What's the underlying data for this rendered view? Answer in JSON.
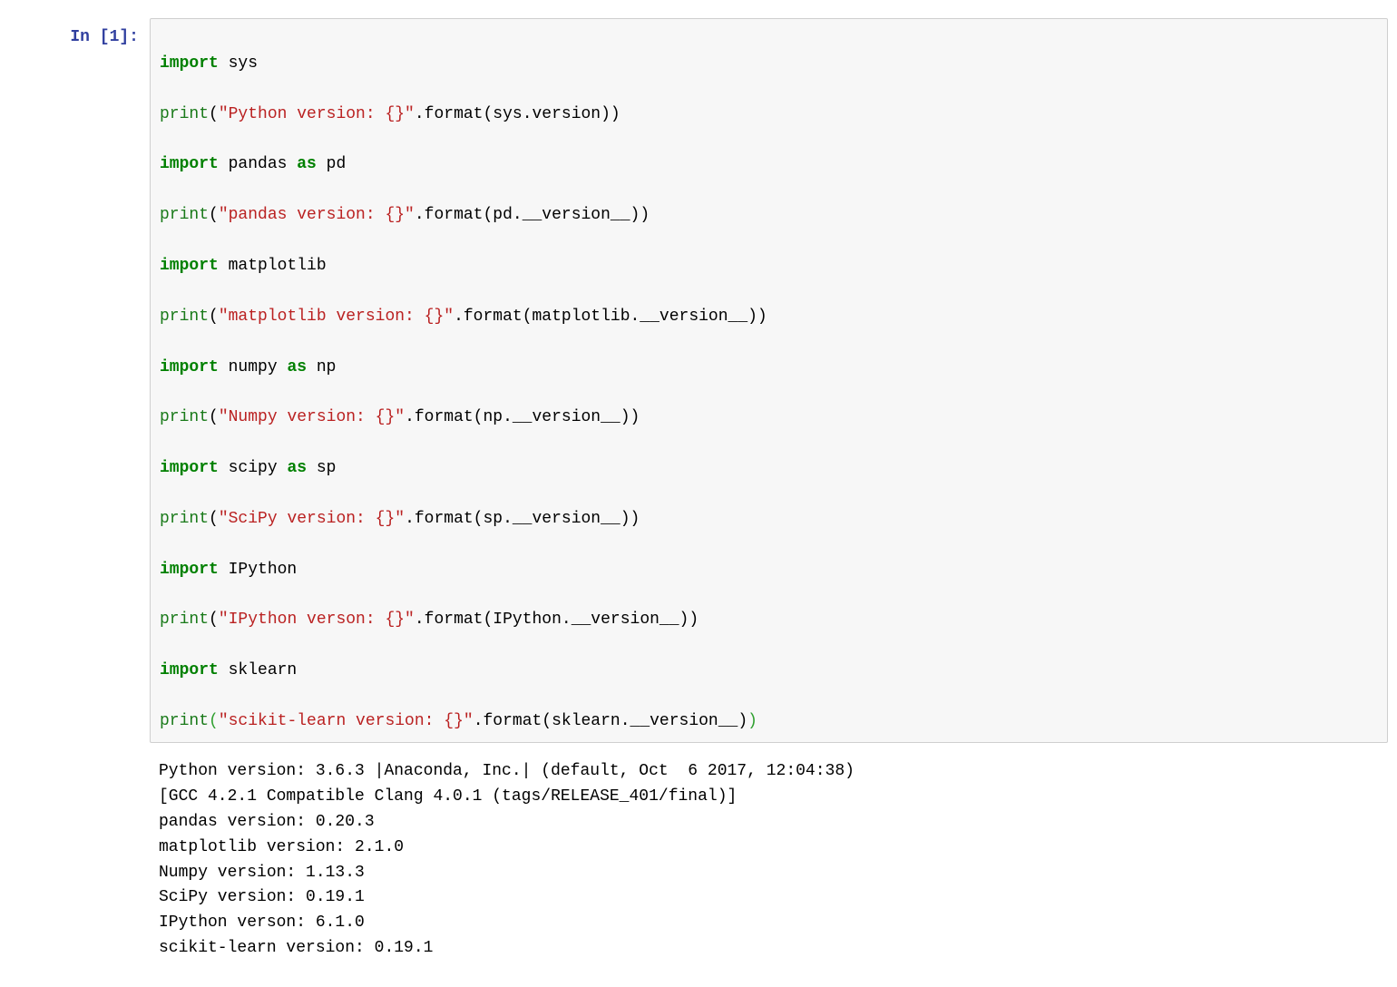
{
  "prompt": {
    "label": "In [1]:"
  },
  "code": {
    "l1": {
      "kw1": "import",
      "a": " sys"
    },
    "l2": {
      "fn": "print",
      "s": "\"Python version: {}\"",
      "rest": ".format(sys.version))"
    },
    "l3": {
      "kw1": "import",
      "a": " pandas ",
      "kw2": "as",
      "b": " pd"
    },
    "l4": {
      "fn": "print",
      "s": "\"pandas version: {}\"",
      "rest": ".format(pd.__version__))"
    },
    "l5": {
      "kw1": "import",
      "a": " matplotlib"
    },
    "l6": {
      "fn": "print",
      "s": "\"matplotlib version: {}\"",
      "rest": ".format(matplotlib.__version__))"
    },
    "l7": {
      "kw1": "import",
      "a": " numpy ",
      "kw2": "as",
      "b": " np"
    },
    "l8": {
      "fn": "print",
      "s": "\"Numpy version: {}\"",
      "rest": ".format(np.__version__))"
    },
    "l9": {
      "kw1": "import",
      "a": " scipy ",
      "kw2": "as",
      "b": " sp"
    },
    "l10": {
      "fn": "print",
      "s": "\"SciPy version: {}\"",
      "rest": ".format(sp.__version__))"
    },
    "l11": {
      "kw1": "import",
      "a": " IPython"
    },
    "l12": {
      "fn": "print",
      "s": "\"IPython verson: {}\"",
      "rest": ".format(IPython.__version__))"
    },
    "l13": {
      "kw1": "import",
      "a": " sklearn"
    },
    "l14": {
      "fn": "print",
      "s": "\"scikit-learn version: {}\"",
      "rest": ".format(sklearn.__version__)"
    }
  },
  "output": {
    "l1": "Python version: 3.6.3 |Anaconda, Inc.| (default, Oct  6 2017, 12:04:38)",
    "l2": "[GCC 4.2.1 Compatible Clang 4.0.1 (tags/RELEASE_401/final)]",
    "l3": "pandas version: 0.20.3",
    "l4": "matplotlib version: 2.1.0",
    "l5": "Numpy version: 1.13.3",
    "l6": "SciPy version: 0.19.1",
    "l7": "IPython verson: 6.1.0",
    "l8": "scikit-learn version: 0.19.1"
  }
}
